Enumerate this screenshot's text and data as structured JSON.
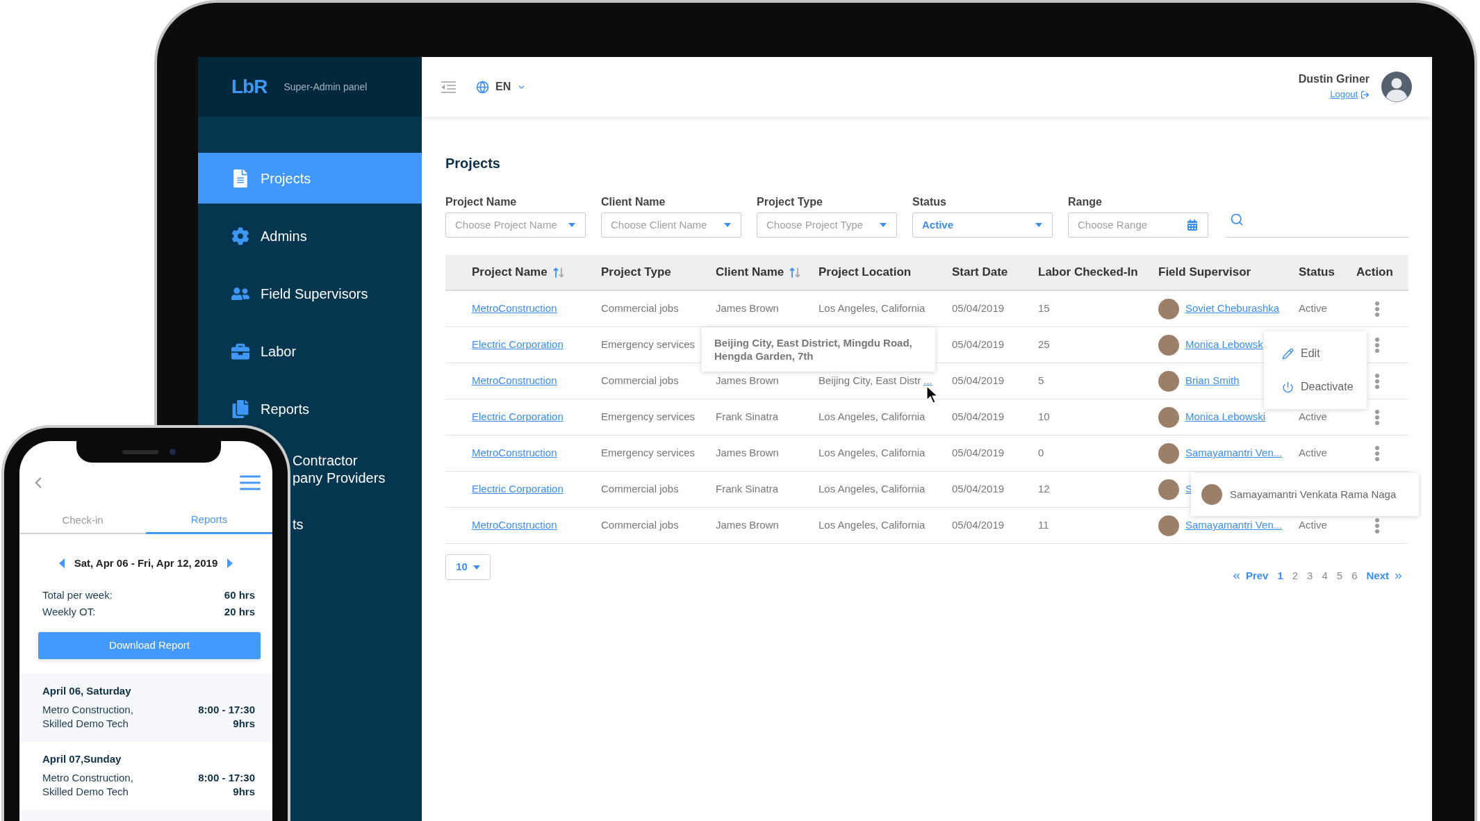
{
  "sidebar": {
    "logo": "LbR",
    "subtitle": "Super-Admin panel",
    "items": [
      {
        "kind": "icon",
        "label": "Projects",
        "selected": true
      },
      {
        "kind": "icon",
        "label": "Admins",
        "selected": false
      },
      {
        "kind": "icon",
        "label": "Field Supervisors",
        "selected": false
      },
      {
        "kind": "icon",
        "label": "Labor",
        "selected": false
      },
      {
        "kind": "icon",
        "label": "Reports",
        "selected": false
      },
      {
        "kind": "covered",
        "lines": [
          "Contractor",
          "pany Providers"
        ],
        "selected": false
      },
      {
        "kind": "covered",
        "lines": [
          "ts"
        ],
        "selected": false
      }
    ]
  },
  "header": {
    "language": "EN",
    "user_name": "Dustin Griner",
    "logout": "Logout"
  },
  "page_title": "Projects",
  "filters": [
    {
      "kind": "select",
      "label": "Project Name",
      "placeholder": "Choose Project Name"
    },
    {
      "kind": "select",
      "label": "Client Name",
      "placeholder": "Choose Client Name"
    },
    {
      "kind": "select",
      "label": "Project Type",
      "placeholder": "Choose Project Type"
    },
    {
      "kind": "select",
      "label": "Status",
      "value": "Active"
    },
    {
      "kind": "date",
      "label": "Range",
      "placeholder": "Choose Range"
    }
  ],
  "table": {
    "columns": [
      {
        "label": "Project Name",
        "sort_ascending": true
      },
      {
        "label": "Project Type"
      },
      {
        "label": "Client Name",
        "sort_ascending": true
      },
      {
        "label": "Project Location"
      },
      {
        "label": "Start Date"
      },
      {
        "label": "Labor Checked-In"
      },
      {
        "label": "Field Supervisor"
      },
      {
        "label": "Status"
      },
      {
        "label": "Action"
      }
    ],
    "rows": [
      {
        "project": "MetroConstruction",
        "type": "Commercial jobs",
        "client": "James Brown",
        "location": "Los Angeles, California",
        "start_date": "05/04/2019",
        "labor": "15",
        "supervisor": "Soviet Cheburashka",
        "status": "Active",
        "actions": true
      },
      {
        "project": "Electric Corporation",
        "type": "Emergency services",
        "start_date": "05/04/2019",
        "labor": "25",
        "supervisor": "Monica Lebowsk",
        "actions": true
      },
      {
        "project": "MetroConstruction",
        "type": "Commercial jobs",
        "client": "James Brown",
        "location": "Beijing City, East Distr",
        "location_more": "...",
        "start_date": "05/04/2019",
        "labor": "5",
        "supervisor": "Brian Smith",
        "actions": true
      },
      {
        "project": "Electric Corporation",
        "type": "Emergency services",
        "client": "Frank Sinatra",
        "location": "Los Angeles, California",
        "start_date": "05/04/2019",
        "labor": "10",
        "supervisor": "Monica Lebowski",
        "status": "Active",
        "actions": true
      },
      {
        "project": "MetroConstruction",
        "type": "Emergency services",
        "client": "James Brown",
        "location": "Los Angeles, California",
        "start_date": "05/04/2019",
        "labor": "0",
        "supervisor": "Samayamantri Ven...",
        "status": "Active",
        "actions": true
      },
      {
        "project": "Electric Corporation",
        "type": "Commercial jobs",
        "client": "Frank Sinatra",
        "location": "Los Angeles, California",
        "start_date": "05/04/2019",
        "labor": "12",
        "supervisor": "S",
        "actions": false
      },
      {
        "project": "MetroConstruction",
        "type": "Commercial jobs",
        "client": "James Brown",
        "location": "Los Angeles, California",
        "start_date": "05/04/2019",
        "labor": "11",
        "supervisor": "Samayamantri Ven...",
        "status": "Active",
        "actions": true
      }
    ]
  },
  "location_tooltip": {
    "text": "Beijing City, East District, Mingdu Road, Hengda Garden, 7th"
  },
  "action_menu": {
    "items": [
      {
        "label": "Edit"
      },
      {
        "label": "Deactivate"
      }
    ]
  },
  "supervisor_tooltip": {
    "name": "Samayamantri Venkata Rama Naga"
  },
  "pagination": {
    "page_size": "10",
    "prev": "Prev",
    "pages": [
      {
        "label": "1",
        "selected": true
      },
      {
        "label": "2",
        "selected": false
      },
      {
        "label": "3",
        "selected": false
      },
      {
        "label": "4",
        "selected": false
      },
      {
        "label": "5",
        "selected": false
      },
      {
        "label": "6",
        "selected": false
      }
    ],
    "next": "Next"
  },
  "phone": {
    "tabs": [
      {
        "label": "Check-in",
        "selected": false
      },
      {
        "label": "Reports",
        "selected": true
      }
    ],
    "week": "Sat, Apr 06 - Fri, Apr 12, 2019",
    "totals": [
      {
        "label": "Total per week:",
        "value": "60 hrs"
      },
      {
        "label": "Weekly OT:",
        "value": "20 hrs"
      }
    ],
    "button": "Download Report",
    "days": [
      {
        "date": "April 06, Saturday",
        "description": "Metro Construction, Skilled Demo Tech",
        "time": "8:00 - 17:30",
        "hours": "9hrs"
      },
      {
        "date": "April 07,Sunday",
        "description": "Metro Construction, Skilled Demo Tech",
        "time": "8:00 - 17:30",
        "hours": "9hrs"
      }
    ]
  }
}
